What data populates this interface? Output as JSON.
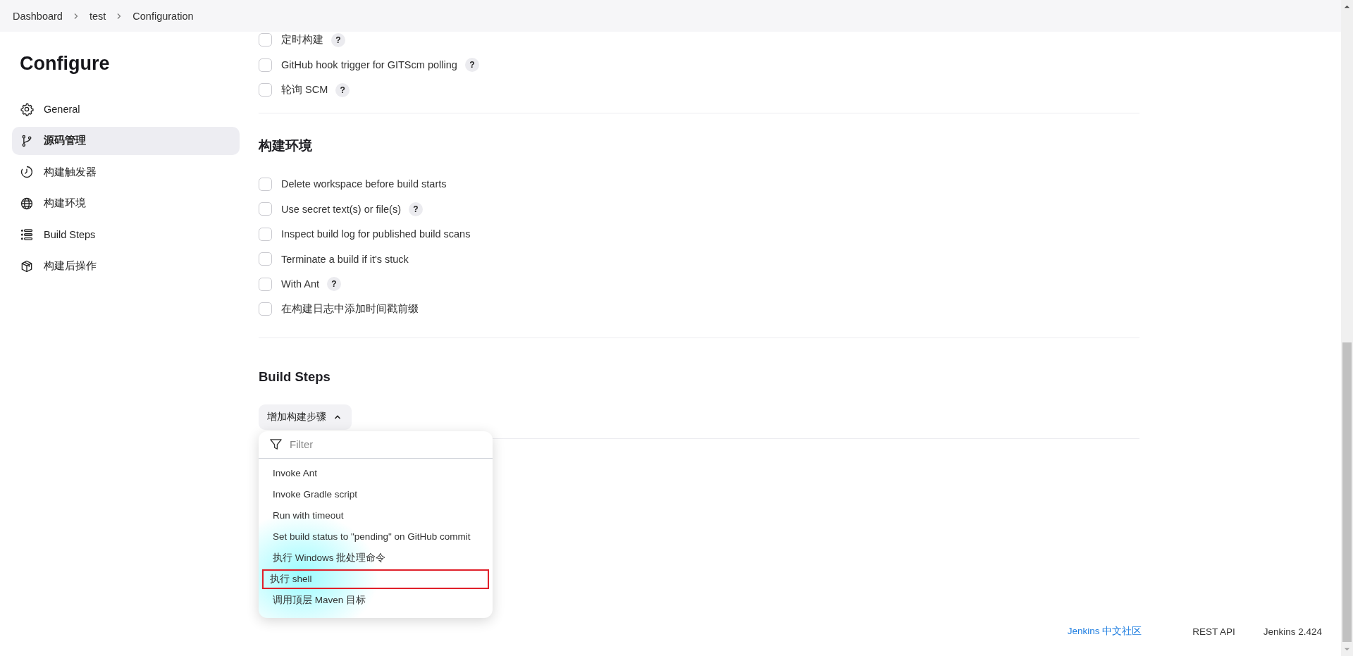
{
  "breadcrumbs": [
    "Dashboard",
    "test",
    "Configuration"
  ],
  "sidebar": {
    "title": "Configure",
    "items": [
      {
        "label": "General",
        "selected": false
      },
      {
        "label": "源码管理",
        "selected": true
      },
      {
        "label": "构建触发器",
        "selected": false
      },
      {
        "label": "构建环境",
        "selected": false
      },
      {
        "label": "Build Steps",
        "selected": false
      },
      {
        "label": "构建后操作",
        "selected": false
      }
    ]
  },
  "triggers": [
    {
      "label": "定时构建",
      "checked": false,
      "help": "?"
    },
    {
      "label": "GitHub hook trigger for GITScm polling",
      "checked": false,
      "help": "?"
    },
    {
      "label": "轮询 SCM",
      "checked": false,
      "help": "?"
    }
  ],
  "build_environment": {
    "title": "构建环境",
    "options": [
      {
        "label": "Delete workspace before build starts",
        "checked": false
      },
      {
        "label": "Use secret text(s) or file(s)",
        "checked": false,
        "help": "?"
      },
      {
        "label": "Inspect build log for published build scans",
        "checked": false
      },
      {
        "label": "Terminate a build if it's stuck",
        "checked": false
      },
      {
        "label": "With Ant",
        "checked": false,
        "help": "?"
      },
      {
        "label": "在构建日志中添加时间戳前缀",
        "checked": false
      }
    ]
  },
  "build_steps": {
    "title": "Build Steps",
    "add_button": "增加构建步骤",
    "menu_open": true,
    "menu": {
      "filter_placeholder": "Filter",
      "items": [
        {
          "label": "Invoke Ant",
          "highlighted": false
        },
        {
          "label": "Invoke Gradle script",
          "highlighted": false
        },
        {
          "label": "Run with timeout",
          "highlighted": false
        },
        {
          "label": "Set build status to \"pending\" on GitHub commit",
          "highlighted": false
        },
        {
          "label": "执行 Windows 批处理命令",
          "highlighted": false
        },
        {
          "label": "执行 shell",
          "highlighted": true
        },
        {
          "label": "调用顶层 Maven 目标",
          "highlighted": false
        }
      ]
    }
  },
  "footer": {
    "community_link": "Jenkins 中文社区",
    "rest_api": "REST API",
    "version": "Jenkins 2.424"
  }
}
